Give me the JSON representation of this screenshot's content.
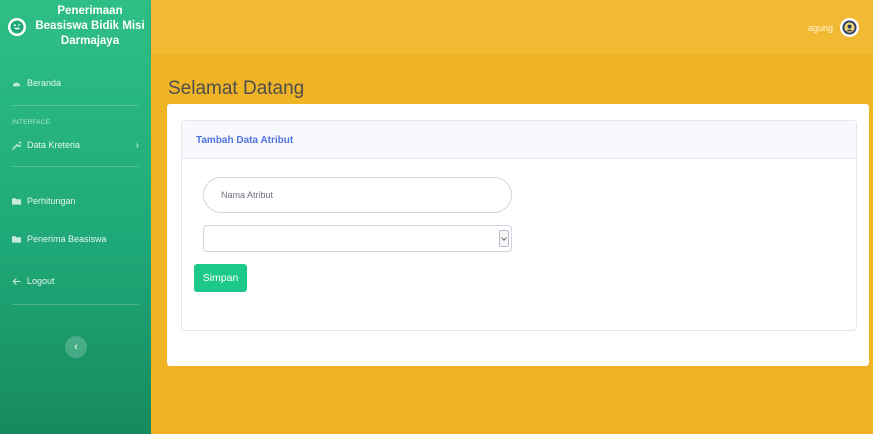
{
  "brand": {
    "title": "Penerimaan Beasiswa Bidik Misi Darmajaya",
    "icon": "laugh-wink-icon"
  },
  "sidebar": {
    "dashboard": {
      "label": "Beranda",
      "icon": "tachometer-icon"
    },
    "section_heading": "INTERFACE",
    "criteria": {
      "label": "Data Kreteria",
      "icon": "wrench-icon",
      "chevron": "›"
    },
    "calculation": {
      "label": "Perhitungan",
      "icon": "folder-icon"
    },
    "recipients": {
      "label": "Penerima Beasiswa",
      "icon": "folder-icon"
    },
    "logout": {
      "label": "Logout",
      "icon": "arrow-left-icon"
    },
    "toggle": {
      "icon": "chevron-left-icon",
      "glyph": "‹"
    }
  },
  "topbar": {
    "username": "agung"
  },
  "main": {
    "page_title": "Selamat Datang",
    "card_title": "Tambah Data Atribut",
    "input_placeholder": "Nama Atribut",
    "select_value": "",
    "save_label": "Simpan"
  },
  "colors": {
    "sidebar_green": "#1fa978",
    "topbar_yellow": "#f2b932",
    "card_header_text": "#4e73df",
    "button_green": "#1cc88a"
  }
}
